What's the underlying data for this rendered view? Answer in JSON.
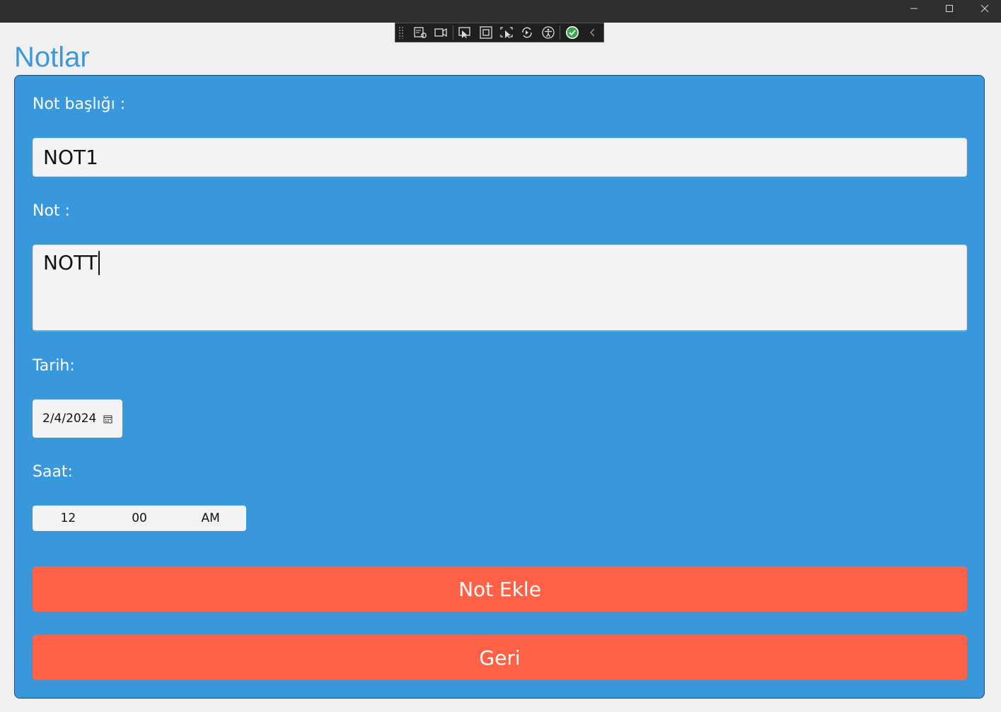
{
  "window": {
    "controls": [
      "minimize",
      "maximize",
      "close"
    ]
  },
  "debug_toolbar": {
    "icons": [
      "live-visual-tree-icon",
      "record-icon",
      "select-element-icon",
      "display-layout-adorners-icon",
      "track-focus-icon",
      "hot-reload-icon",
      "accessibility-icon",
      "binding-check-icon",
      "collapse-icon"
    ]
  },
  "page": {
    "title": "Notlar"
  },
  "form": {
    "note_title_label": "Not başlığı :",
    "note_title_value": "NOT1",
    "note_label": "Not :",
    "note_value": "NOTT",
    "date_label": "Tarih:",
    "date_value": "2/4/2024",
    "time_label": "Saat:",
    "time_hour": "12",
    "time_minute": "00",
    "time_period": "AM"
  },
  "buttons": {
    "add_note": "Not Ekle",
    "back": "Geri"
  },
  "colors": {
    "title": "#3a99dc",
    "card": "#3998dc",
    "button": "#ff6147",
    "input": "#f3f3f3"
  }
}
